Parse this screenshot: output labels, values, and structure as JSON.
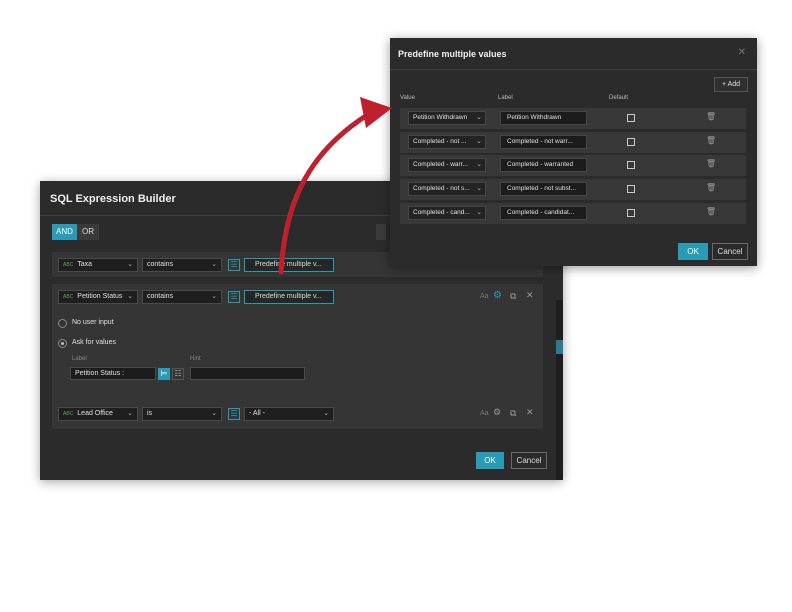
{
  "sql_builder": {
    "title": "SQL Expression Builder",
    "logic": {
      "and": "AND",
      "or": "OR",
      "selected": "AND"
    },
    "clauses": [
      {
        "field": "Taxa",
        "operator": "contains",
        "value": "Predefine multiple v..."
      },
      {
        "field": "Petition Status",
        "operator": "contains",
        "value": "Predefine multiple v...",
        "options": {
          "no_user_input": "No user input",
          "ask_for_values": "Ask for values",
          "selected": "Ask for values",
          "label_heading": "Label",
          "hint_heading": "Hint",
          "label_value": "Petition Status :",
          "hint_value": ""
        }
      },
      {
        "field": "Lead Office",
        "operator": "is",
        "value": "- All -"
      }
    ],
    "aa": "Aa",
    "field_type_badge": "ABC",
    "ok": "OK",
    "cancel": "Cancel"
  },
  "predefine": {
    "title": "Predefine multiple values",
    "add": "+ Add",
    "columns": {
      "value": "Value",
      "label": "Label",
      "default": "Default"
    },
    "rows": [
      {
        "value": "Petition Withdrawn",
        "label": "Petition Withdrawn"
      },
      {
        "value": "Completed - not ...",
        "label": "Completed - not warr..."
      },
      {
        "value": "Completed - warr...",
        "label": "Completed - warranted"
      },
      {
        "value": "Completed - not s...",
        "label": "Completed - not subst..."
      },
      {
        "value": "Completed - cand...",
        "label": "Completed - candidat..."
      }
    ],
    "ok": "OK",
    "cancel": "Cancel"
  },
  "colors": {
    "accent": "#2a9bb5",
    "arrow": "#c0202e",
    "panel": "#2b2b2b"
  }
}
